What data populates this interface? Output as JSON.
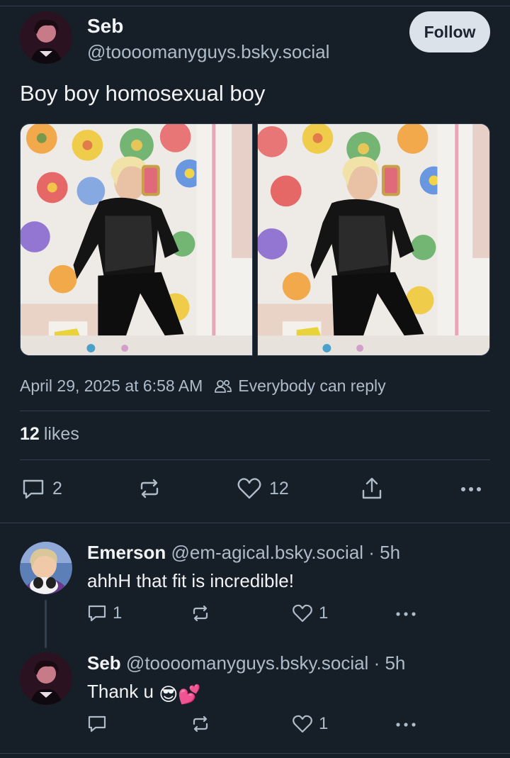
{
  "post": {
    "author_name": "Seb",
    "author_handle": "@toooomanyguys.bsky.social",
    "follow_label": "Follow",
    "text": "Boy boy homosexual boy",
    "date": "April 29, 2025 at 6:58 AM",
    "reply_setting": "Everybody can reply",
    "likes_count": "12",
    "likes_label": "likes",
    "reply_count": "2",
    "like_count": "12"
  },
  "replies": [
    {
      "name": "Emerson",
      "handle": "@em-agical.bsky.social",
      "time": "· 5h",
      "text": "ahhH that fit is incredible!",
      "reply_count": "1",
      "like_count": "1"
    },
    {
      "name": "Seb",
      "handle": "@toooomanyguys.bsky.social",
      "time": "· 5h",
      "text": "Thank u",
      "emojis": "😎💕",
      "like_count": "1"
    }
  ],
  "icons": {
    "reply": "speech-bubble-icon",
    "repost": "repost-icon",
    "like": "heart-icon",
    "share": "share-icon",
    "more": "more-dots-icon",
    "people": "people-icon"
  },
  "colors": {
    "background": "#161e27",
    "muted_text": "#aebbc9",
    "follow_button": "#dce2ea"
  }
}
